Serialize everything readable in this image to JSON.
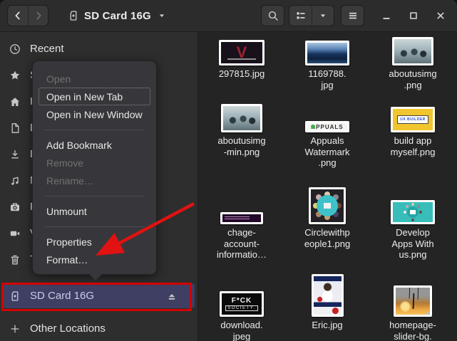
{
  "header": {
    "title": "SD Card 16G",
    "back_icon": "chevron-left-icon",
    "forward_icon": "chevron-right-icon",
    "location_icon": "sd-card-icon",
    "caret_icon": "chevron-down-icon",
    "search_icon": "search-icon",
    "view_icon": "list-view-icon",
    "view_caret_icon": "chevron-down-icon",
    "menu_icon": "hamburger-icon",
    "minimize_icon": "minimize-icon",
    "maximize_icon": "maximize-icon",
    "close_icon": "close-icon"
  },
  "sidebar": {
    "items": [
      {
        "icon": "clock-icon",
        "label": "Recent"
      },
      {
        "icon": "star-icon",
        "label": "Starred"
      },
      {
        "icon": "home-icon",
        "label": "Home"
      },
      {
        "icon": "document-icon",
        "label": "Documents"
      },
      {
        "icon": "download-icon",
        "label": "Downloads"
      },
      {
        "icon": "music-icon",
        "label": "Music"
      },
      {
        "icon": "camera-icon",
        "label": "Pictures"
      },
      {
        "icon": "video-icon",
        "label": "Videos"
      },
      {
        "icon": "trash-icon",
        "label": "Trash"
      }
    ],
    "device": {
      "icon": "sd-card-icon",
      "label": "SD Card 16G",
      "eject_icon": "eject-icon"
    },
    "other": {
      "icon": "plus-icon",
      "label": "Other Locations"
    }
  },
  "context_menu": {
    "items": [
      {
        "label": "Open",
        "disabled": true
      },
      {
        "label": "Open in New Tab",
        "focused": true
      },
      {
        "label": "Open in New Window"
      },
      {
        "separator": true
      },
      {
        "label": "Add Bookmark"
      },
      {
        "label": "Remove",
        "disabled": true
      },
      {
        "label": "Rename…",
        "disabled": true
      },
      {
        "separator": true
      },
      {
        "label": "Unmount"
      },
      {
        "separator": true
      },
      {
        "label": "Properties"
      },
      {
        "label": "Format…"
      }
    ]
  },
  "files": [
    {
      "name": "297815.jpg",
      "thumb": "v-poster",
      "thumb_text": "V"
    },
    {
      "name": "1169788.\njpg",
      "thumb": "lake"
    },
    {
      "name": "aboutusimg\n.png",
      "thumb": "meeting"
    },
    {
      "name": "aboutusimg\n-min.png",
      "thumb": "meeting"
    },
    {
      "name": "Appuals\nWatermark\n.png",
      "thumb": "appuals",
      "thumb_text": "APPUALS"
    },
    {
      "name": "build app\nmyself.png",
      "thumb": "uxbuilder",
      "thumb_text": "UX BUILDER"
    },
    {
      "name": "chage-\naccount-\ninformatio…",
      "thumb": "terminal"
    },
    {
      "name": "Circlewithp\neople1.png",
      "thumb": "circle"
    },
    {
      "name": "Develop\nApps With\nus.png",
      "thumb": "develop"
    },
    {
      "name": "download.\njpeg",
      "thumb": "fsociety",
      "thumb_text": "F*CK\nSOCIETY."
    },
    {
      "name": "Eric.jpg",
      "thumb": "eric"
    },
    {
      "name": "homepage-\nslider-bg.",
      "thumb": "sunset"
    }
  ],
  "colors": {
    "selected_row_bg": "#3f3f63",
    "selected_row_text": "#cacae8",
    "annotation_red": "#d40000",
    "arrow_red": "#e01212"
  }
}
